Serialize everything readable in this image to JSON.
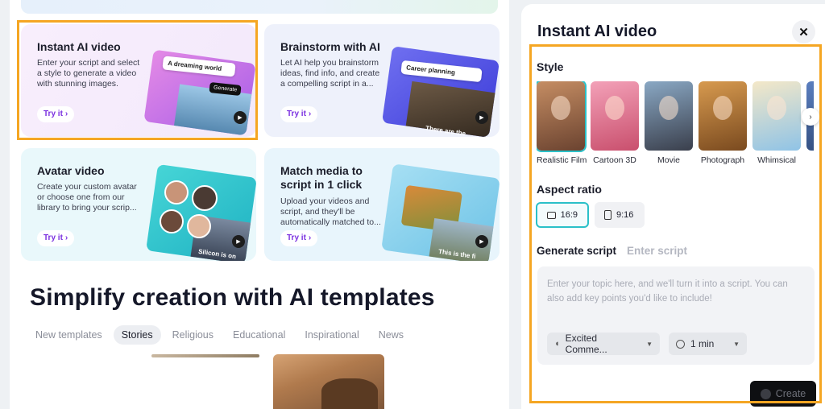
{
  "cards": [
    {
      "title": "Instant AI video",
      "desc": "Enter your script and select a style to generate a video with stunning images.",
      "cta": "Try it",
      "art_chip": "A dreaming world",
      "art_button": "Generate"
    },
    {
      "title": "Brainstorm with AI",
      "desc": "Let AI help you brainstorm ideas, find info, and create a compelling script in a...",
      "cta": "Try it",
      "art_chip": "Career planning",
      "art_caption": "There are the"
    },
    {
      "title": "Avatar video",
      "desc": "Create your custom avatar or choose one from our library to bring your scrip...",
      "cta": "Try it",
      "art_caption": "Silicon is on"
    },
    {
      "title": "Match media to script in 1 click",
      "desc": "Upload your videos and script, and they'll be automatically matched to...",
      "cta": "Try it",
      "art_caption": "This is the fi"
    }
  ],
  "templates_heading": "Simplify creation with AI templates",
  "template_tabs": [
    "New templates",
    "Stories",
    "Religious",
    "Educational",
    "Inspirational",
    "News"
  ],
  "active_tab": "Stories",
  "panel": {
    "title": "Instant AI video",
    "style_label": "Style",
    "styles": [
      {
        "name": "Realistic Film",
        "selected": true,
        "colors": [
          "#c58d63",
          "#6b4330"
        ]
      },
      {
        "name": "Cartoon 3D",
        "selected": false,
        "colors": [
          "#f3a1b8",
          "#c94f6d"
        ]
      },
      {
        "name": "Movie",
        "selected": false,
        "colors": [
          "#8aa8c4",
          "#3a3f4c"
        ]
      },
      {
        "name": "Photograph",
        "selected": false,
        "colors": [
          "#d79a4f",
          "#7a4a1f"
        ]
      },
      {
        "name": "Whimsical",
        "selected": false,
        "colors": [
          "#f4e8c8",
          "#8fc3e6"
        ]
      },
      {
        "name": "",
        "selected": false,
        "colors": [
          "#5b7fbf",
          "#2f4a7a"
        ]
      }
    ],
    "aspect_label": "Aspect ratio",
    "aspects": [
      {
        "label": "16:9",
        "selected": true
      },
      {
        "label": "9:16",
        "selected": false
      }
    ],
    "script_tabs": {
      "generate": "Generate script",
      "enter": "Enter script"
    },
    "placeholder": "Enter your topic here, and we'll turn it into a script. You can also add key points you'd like to include!",
    "voice": "Excited Comme...",
    "duration": "1 min",
    "create": "Create"
  },
  "colors": {
    "accent": "#7a2fe0",
    "highlight": "#f5a623",
    "selection": "#2ac0c8"
  }
}
